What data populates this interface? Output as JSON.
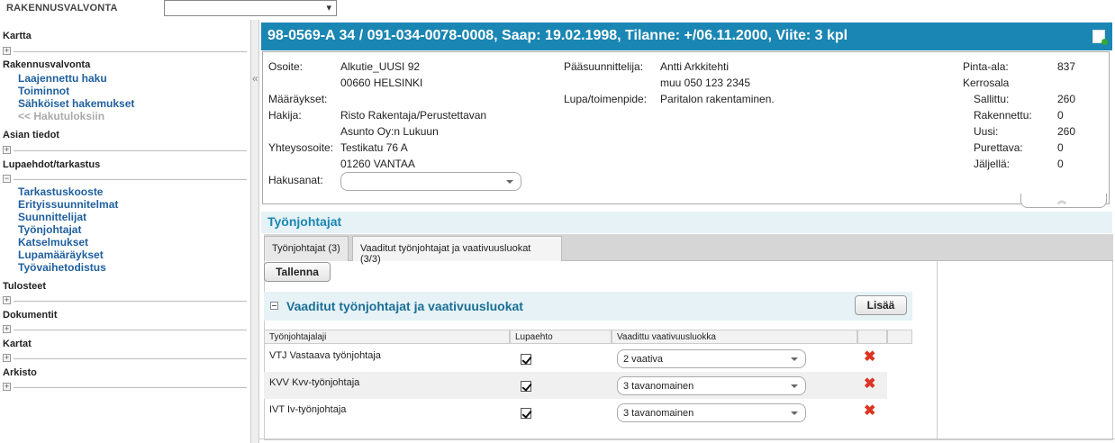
{
  "topbar": {
    "title": "RAKENNUSVALVONTA",
    "select_value": ""
  },
  "sidebar": {
    "sections": [
      {
        "label": "Kartta",
        "toggle": "+"
      },
      {
        "label": "Rakennusvalvonta",
        "links": [
          "Laajennettu haku",
          "Toiminnot",
          "Sähköiset hakemukset"
        ],
        "disabled_link": "<< Hakutuloksiin"
      },
      {
        "label": "Asian tiedot",
        "toggle": "+"
      },
      {
        "label": "Lupaehdot/tarkastus",
        "toggle": "−",
        "links": [
          "Tarkastuskooste",
          "Erityissuunnitelmat",
          "Suunnittelijat",
          "Työnjohtajat",
          "Katselmukset",
          "Lupamääräykset",
          "Työvaihetodistus"
        ]
      },
      {
        "label": "Tulosteet",
        "toggle": "+"
      },
      {
        "label": "Dokumentit",
        "toggle": "+"
      },
      {
        "label": "Kartat",
        "toggle": "+"
      },
      {
        "label": "Arkisto",
        "toggle": "+"
      }
    ],
    "collapse_glyph": "«"
  },
  "banner": {
    "title": "98-0569-A 34 / 091-034-0078-0008, Saap: 19.02.1998, Tilanne: +/06.11.2000, Viite: 3 kpl"
  },
  "info": {
    "osoite_label": "Osoite:",
    "osoite_1": "Alkutie_UUSI 92",
    "osoite_2": "00660 HELSINKI",
    "maaraykset_label": "Määräykset:",
    "hakija_label": "Hakija:",
    "hakija_1": "Risto Rakentaja/Perustettavan",
    "hakija_2": "Asunto Oy:n Lukuun",
    "yhteys_label": "Yhteysosoite:",
    "yhteys_1": "Testikatu 76 A",
    "yhteys_2": "01260 VANTAA",
    "hakusanat_label": "Hakusanat:",
    "hakusanat_value": "",
    "paasuunnittelija_label": "Pääsuunnittelija:",
    "paasuunnittelija_1": "Antti Arkkitehti",
    "paasuunnittelija_2": "muu 050 123 2345",
    "lupa_label": "Lupa/toimenpide:",
    "lupa_value": "Paritalon rakentaminen.",
    "pinta_label": "Pinta-ala:",
    "pinta_value": "837",
    "kerrosala_label": "Kerrosala",
    "sallittu_label": "Sallittu:",
    "sallittu_value": "260",
    "rakennettu_label": "Rakennettu:",
    "rakennettu_value": "0",
    "uusi_label": "Uusi:",
    "uusi_value": "260",
    "purettava_label": "Purettava:",
    "purettava_value": "0",
    "jaljella_label": "Jäljellä:",
    "jaljella_value": "0",
    "collapse_glyph": "︽"
  },
  "section": {
    "title": "Työnjohtajat"
  },
  "tabs": [
    {
      "label": "Työnjohtajat (3)"
    },
    {
      "label": "Vaaditut työnjohtajat ja vaativuusluokat (3/3)"
    }
  ],
  "actions": {
    "save_label": "Tallenna",
    "add_label": "Lisää"
  },
  "subsection": {
    "title": "Vaaditut työnjohtajat ja vaativuusluokat"
  },
  "grid": {
    "headers": [
      "Työnjohtajalaji",
      "Lupaehto",
      "Vaadittu vaativuusluokka"
    ],
    "rows": [
      {
        "laji": "VTJ Vastaava työnjohtaja",
        "lupaehto": true,
        "luokka": "2   vaativa"
      },
      {
        "laji": "KVV Kvv-työnjohtaja",
        "lupaehto": true,
        "luokka": "3   tavanomainen"
      },
      {
        "laji": "IVT Iv-työnjohtaja",
        "lupaehto": true,
        "luokka": "3   tavanomainen"
      }
    ],
    "delete_glyph": "✖"
  }
}
